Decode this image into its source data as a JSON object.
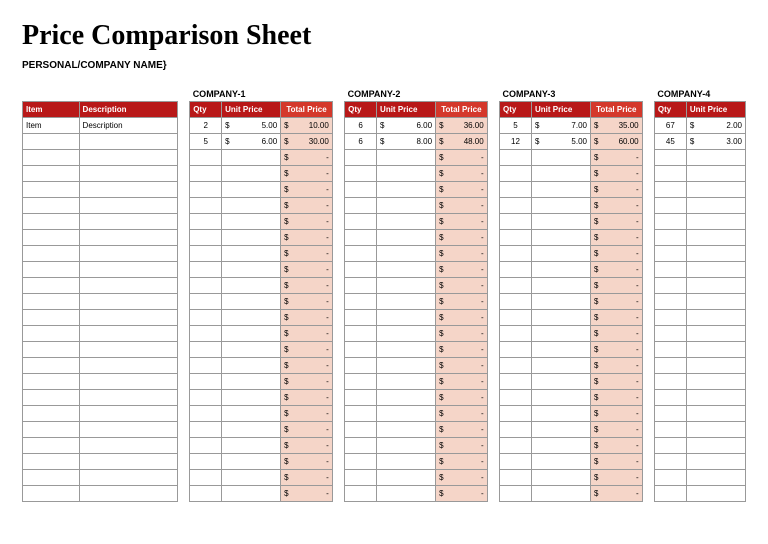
{
  "title": "Price Comparison Sheet",
  "subtitle": "PERSONAL/COMPANY NAME}",
  "headers": {
    "item": "Item",
    "description": "Description",
    "qty": "Qty",
    "unit_price": "Unit Price",
    "total_price": "Total Price"
  },
  "currency": "$",
  "dash": "-",
  "companies": [
    {
      "name": "COMPANY-1",
      "rows": [
        {
          "qty": "2",
          "unit_price": "5.00",
          "total": "10.00"
        },
        {
          "qty": "5",
          "unit_price": "6.00",
          "total": "30.00"
        }
      ]
    },
    {
      "name": "COMPANY-2",
      "rows": [
        {
          "qty": "6",
          "unit_price": "6.00",
          "total": "36.00"
        },
        {
          "qty": "6",
          "unit_price": "8.00",
          "total": "48.00"
        }
      ]
    },
    {
      "name": "COMPANY-3",
      "rows": [
        {
          "qty": "5",
          "unit_price": "7.00",
          "total": "35.00"
        },
        {
          "qty": "12",
          "unit_price": "5.00",
          "total": "60.00"
        }
      ]
    },
    {
      "name": "COMPANY-4",
      "rows": [
        {
          "qty": "67",
          "unit_price": "2.00",
          "total": ""
        },
        {
          "qty": "45",
          "unit_price": "3.00",
          "total": ""
        }
      ]
    }
  ],
  "first_row": {
    "item": "Item",
    "description": "Description"
  },
  "empty_rows": 22
}
